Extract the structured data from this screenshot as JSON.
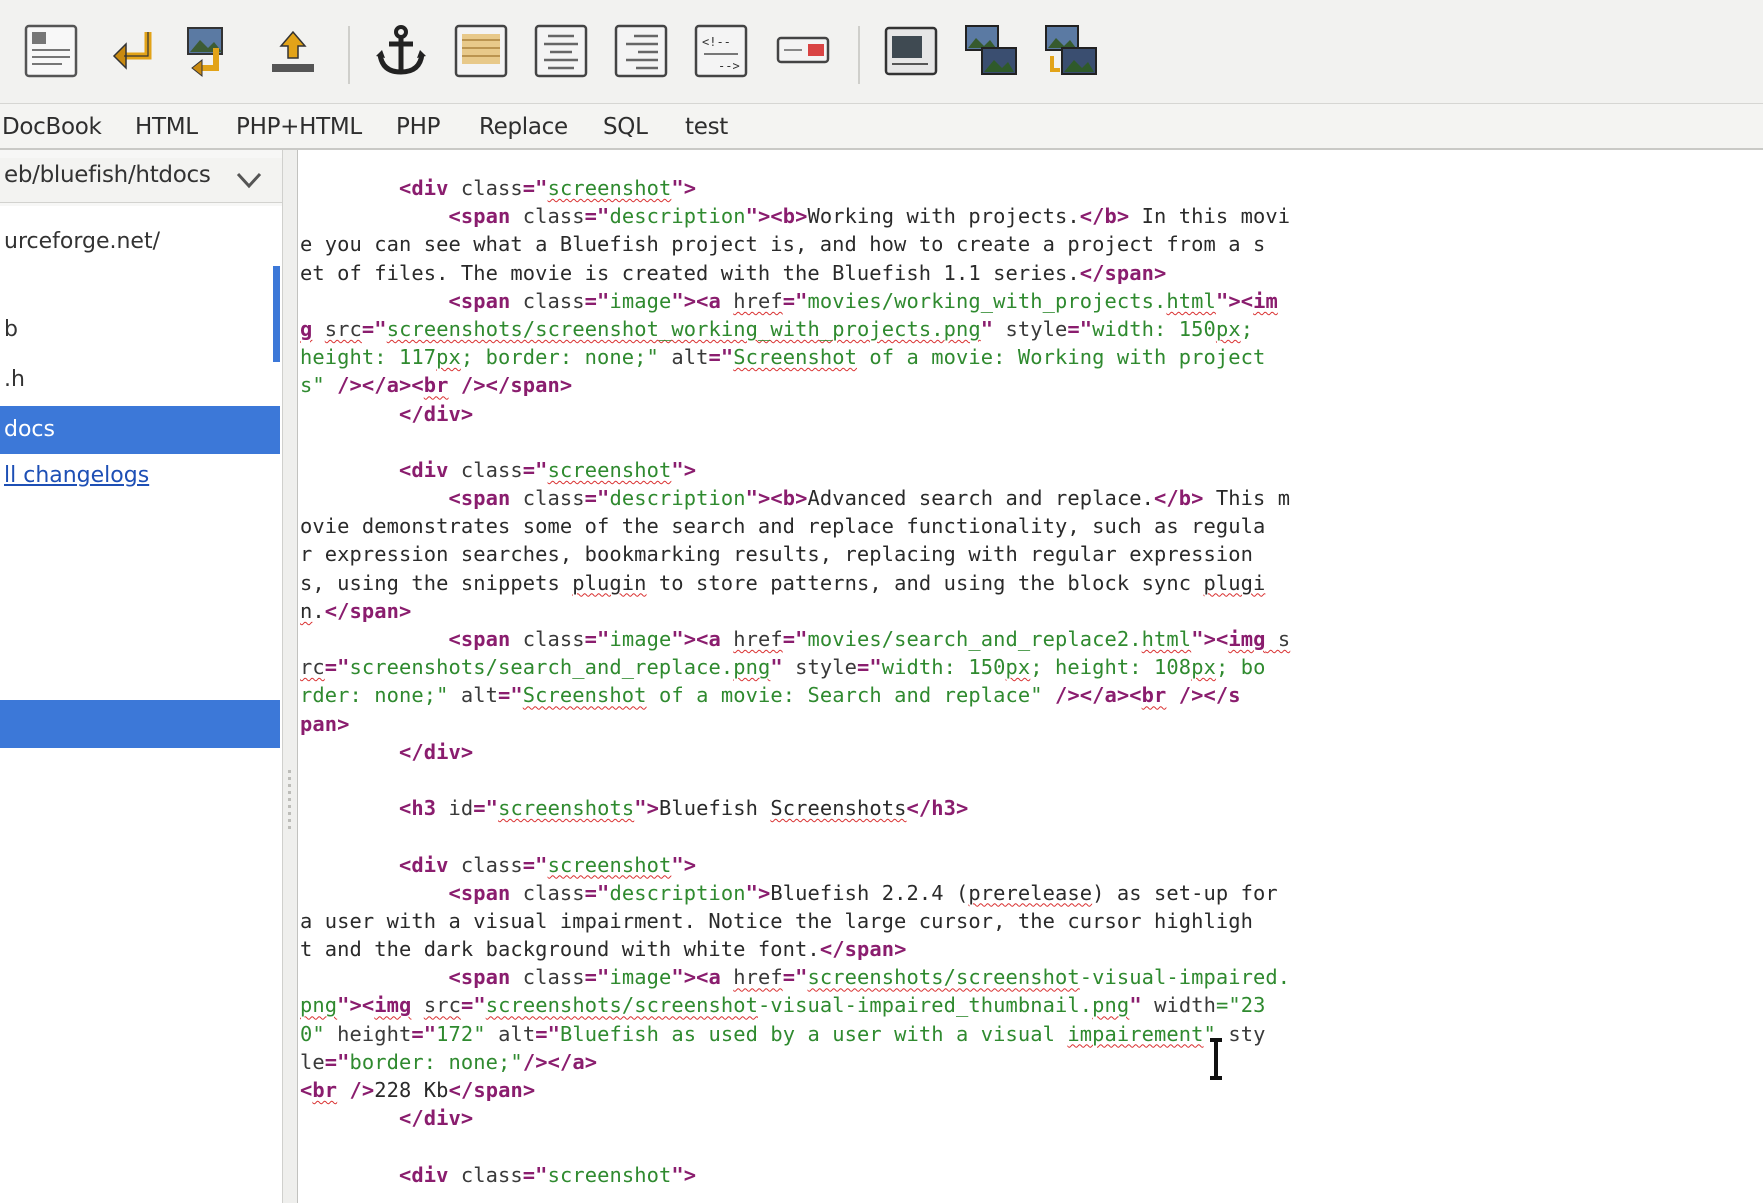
{
  "toolbar": {
    "buttons": [
      {
        "icon": "document-icon"
      },
      {
        "icon": "return-arrow-icon"
      },
      {
        "icon": "image-insert-icon"
      },
      {
        "icon": "upload-icon"
      },
      {
        "icon": "anchor-icon"
      },
      {
        "icon": "paragraph-icon"
      },
      {
        "icon": "align-center-icon"
      },
      {
        "icon": "align-right-icon"
      },
      {
        "icon": "comment-icon"
      },
      {
        "icon": "input-field-icon"
      },
      {
        "icon": "frame-icon"
      },
      {
        "icon": "thumbnail-icon"
      },
      {
        "icon": "multi-thumbnail-icon"
      }
    ]
  },
  "tabs": [
    "DocBook",
    "HTML",
    "PHP+HTML",
    "PHP",
    "Replace",
    "SQL",
    "test"
  ],
  "sidebar": {
    "path": "eb/bluefish/htdocs",
    "items": [
      {
        "label": "urceforge.net/",
        "type": "normal"
      },
      {
        "label": "",
        "type": "normal"
      },
      {
        "label": "b",
        "type": "normal"
      },
      {
        "label": ".h",
        "type": "normal"
      },
      {
        "label": "docs",
        "type": "selected"
      },
      {
        "label": "ll changelogs",
        "type": "link"
      },
      {
        "label": "",
        "type": "selected-empty"
      }
    ]
  },
  "colors": {
    "selection": "#3c78d8",
    "tag": "#8a1d6e",
    "string": "#2f8a2f",
    "spell_error": "#d93030"
  },
  "editor": {
    "lines": [
      [
        [
          "        ",
          "txt"
        ],
        [
          "<div ",
          "tag"
        ],
        [
          "class",
          "attr"
        ],
        [
          "=\"",
          "tag"
        ],
        [
          "screenshot",
          "str-sp"
        ],
        [
          "\">",
          "tag"
        ]
      ],
      [
        [
          "            ",
          "txt"
        ],
        [
          "<span ",
          "tag"
        ],
        [
          "class",
          "attr"
        ],
        [
          "=\"",
          "tag"
        ],
        [
          "description",
          "str"
        ],
        [
          "\"><b>",
          "tag"
        ],
        [
          "Working with projects.",
          "txt"
        ],
        [
          "</b>",
          "tag"
        ],
        [
          " In this movi",
          "txt"
        ]
      ],
      [
        [
          "e you can see what a Bluefish project is, and how to create a project from a s",
          "txt"
        ]
      ],
      [
        [
          "et of files. The movie is created with the Bluefish 1.1 series.",
          "txt"
        ],
        [
          "</span>",
          "tag"
        ]
      ],
      [
        [
          "            ",
          "txt"
        ],
        [
          "<span ",
          "tag"
        ],
        [
          "class",
          "attr"
        ],
        [
          "=\"",
          "tag"
        ],
        [
          "image",
          "str"
        ],
        [
          "\"><a ",
          "tag"
        ],
        [
          "href",
          "attr-sp"
        ],
        [
          "=\"",
          "tag"
        ],
        [
          "movies/working_with_projects.",
          "str"
        ],
        [
          "html",
          "str-sp"
        ],
        [
          "\"><",
          "tag"
        ],
        [
          "im",
          "tag-sp"
        ]
      ],
      [
        [
          "g",
          "tag-sp"
        ],
        [
          " ",
          "txt"
        ],
        [
          "src",
          "attr-sp"
        ],
        [
          "=\"",
          "tag"
        ],
        [
          "screenshots/screenshot_working_with_projects.png",
          "str-sp"
        ],
        [
          "\" ",
          "tag"
        ],
        [
          "style",
          "attr"
        ],
        [
          "=\"",
          "tag"
        ],
        [
          "width: 150",
          "str"
        ],
        [
          "px",
          "str-sp"
        ],
        [
          ";",
          "str"
        ]
      ],
      [
        [
          "height: 117",
          "str"
        ],
        [
          "px",
          "str-sp"
        ],
        [
          "; border: none;\" ",
          "str"
        ],
        [
          "alt",
          "attr"
        ],
        [
          "=\"",
          "tag"
        ],
        [
          "Screenshot",
          "str-sp"
        ],
        [
          " of a movie: Working with project",
          "str"
        ]
      ],
      [
        [
          "s\"",
          "str"
        ],
        [
          " /></a><",
          "tag"
        ],
        [
          "br",
          "tag-sp"
        ],
        [
          " /></span>",
          "tag"
        ]
      ],
      [
        [
          "        ",
          "txt"
        ],
        [
          "</div>",
          "tag"
        ]
      ],
      [
        [
          "",
          "txt"
        ]
      ],
      [
        [
          "        ",
          "txt"
        ],
        [
          "<div ",
          "tag"
        ],
        [
          "class",
          "attr"
        ],
        [
          "=\"",
          "tag"
        ],
        [
          "screenshot",
          "str-sp"
        ],
        [
          "\">",
          "tag"
        ]
      ],
      [
        [
          "            ",
          "txt"
        ],
        [
          "<span ",
          "tag"
        ],
        [
          "class",
          "attr"
        ],
        [
          "=\"",
          "tag"
        ],
        [
          "description",
          "str"
        ],
        [
          "\"><b>",
          "tag"
        ],
        [
          "Advanced search and replace.",
          "txt"
        ],
        [
          "</b>",
          "tag"
        ],
        [
          " This m",
          "txt"
        ]
      ],
      [
        [
          "ovie demonstrates some of the search and replace functionality, such as regula",
          "txt"
        ]
      ],
      [
        [
          "r expression searches, bookmarking results, replacing with regular expression",
          "txt"
        ]
      ],
      [
        [
          "s, using the snippets ",
          "txt"
        ],
        [
          "plugin",
          "txt-sp"
        ],
        [
          " to store patterns, and using the block sync ",
          "txt"
        ],
        [
          "plugi",
          "txt-sp"
        ]
      ],
      [
        [
          "n",
          "txt-sp"
        ],
        [
          ".",
          "txt"
        ],
        [
          "</span>",
          "tag"
        ]
      ],
      [
        [
          "            ",
          "txt"
        ],
        [
          "<span ",
          "tag"
        ],
        [
          "class",
          "attr"
        ],
        [
          "=\"",
          "tag"
        ],
        [
          "image",
          "str"
        ],
        [
          "\"><a ",
          "tag"
        ],
        [
          "href",
          "attr-sp"
        ],
        [
          "=\"",
          "tag"
        ],
        [
          "movies/search_and_replace2.",
          "str"
        ],
        [
          "html",
          "str-sp"
        ],
        [
          "\"><",
          "tag"
        ],
        [
          "img",
          "tag-sp"
        ],
        [
          " s",
          "attr-sp"
        ]
      ],
      [
        [
          "rc",
          "attr-sp"
        ],
        [
          "=\"",
          "tag"
        ],
        [
          "screenshots/search_and_replace.",
          "str"
        ],
        [
          "png",
          "str-sp"
        ],
        [
          "\" ",
          "tag"
        ],
        [
          "style",
          "attr"
        ],
        [
          "=\"",
          "tag"
        ],
        [
          "width: 150",
          "str"
        ],
        [
          "px",
          "str-sp"
        ],
        [
          "; height: 108",
          "str"
        ],
        [
          "px",
          "str-sp"
        ],
        [
          "; bo",
          "str"
        ]
      ],
      [
        [
          "rder: none;\" ",
          "str"
        ],
        [
          "alt",
          "attr"
        ],
        [
          "=\"",
          "tag"
        ],
        [
          "Screenshot",
          "str-sp"
        ],
        [
          " of a movie: Search and replace\"",
          "str"
        ],
        [
          " /></a><",
          "tag"
        ],
        [
          "br",
          "tag-sp"
        ],
        [
          " /></s",
          "tag"
        ]
      ],
      [
        [
          "pan>",
          "tag"
        ]
      ],
      [
        [
          "        ",
          "txt"
        ],
        [
          "</div>",
          "tag"
        ]
      ],
      [
        [
          "",
          "txt"
        ]
      ],
      [
        [
          "        ",
          "txt"
        ],
        [
          "<h3 ",
          "tag"
        ],
        [
          "id",
          "attr"
        ],
        [
          "=\"",
          "tag"
        ],
        [
          "screenshots",
          "str-sp"
        ],
        [
          "\">",
          "tag"
        ],
        [
          "Bluefish ",
          "txt"
        ],
        [
          "Screenshots",
          "txt-sp"
        ],
        [
          "</h3>",
          "tag"
        ]
      ],
      [
        [
          "",
          "txt"
        ]
      ],
      [
        [
          "        ",
          "txt"
        ],
        [
          "<div ",
          "tag"
        ],
        [
          "class",
          "attr"
        ],
        [
          "=\"",
          "tag"
        ],
        [
          "screenshot",
          "str-sp"
        ],
        [
          "\">",
          "tag"
        ]
      ],
      [
        [
          "            ",
          "txt"
        ],
        [
          "<span ",
          "tag"
        ],
        [
          "class",
          "attr"
        ],
        [
          "=\"",
          "tag"
        ],
        [
          "description",
          "str"
        ],
        [
          "\">",
          "tag"
        ],
        [
          "Bluefish 2.2.4 (",
          "txt"
        ],
        [
          "prerelease",
          "txt-sp"
        ],
        [
          ") as set-up for",
          "txt"
        ]
      ],
      [
        [
          "a user with a visual impairment. Notice the large cursor, the cursor highligh",
          "txt"
        ]
      ],
      [
        [
          "t and the dark background with white font.",
          "txt"
        ],
        [
          "</span>",
          "tag"
        ]
      ],
      [
        [
          "            ",
          "txt"
        ],
        [
          "<span ",
          "tag"
        ],
        [
          "class",
          "attr"
        ],
        [
          "=\"",
          "tag"
        ],
        [
          "image",
          "str"
        ],
        [
          "\"><a ",
          "tag"
        ],
        [
          "href",
          "attr-sp"
        ],
        [
          "=\"",
          "tag"
        ],
        [
          "screenshots/screenshot",
          "str-sp"
        ],
        [
          "-visual-impaired.",
          "str"
        ]
      ],
      [
        [
          "png",
          "str-sp"
        ],
        [
          "\"><",
          "tag"
        ],
        [
          "img",
          "tag-sp"
        ],
        [
          " ",
          "txt"
        ],
        [
          "src",
          "attr-sp"
        ],
        [
          "=\"",
          "tag"
        ],
        [
          "screenshots/screenshot",
          "str-sp"
        ],
        [
          "-visual-impaired_thumbnail.",
          "str"
        ],
        [
          "png",
          "str-sp"
        ],
        [
          "\" ",
          "tag"
        ],
        [
          "width",
          "attr"
        ],
        [
          "=\"23",
          "str"
        ]
      ],
      [
        [
          "0\" ",
          "str"
        ],
        [
          "height",
          "attr"
        ],
        [
          "=\"",
          "tag"
        ],
        [
          "172\" ",
          "str"
        ],
        [
          "alt",
          "attr"
        ],
        [
          "=\"",
          "tag"
        ],
        [
          "Bluefish as used by a user with a visual ",
          "str"
        ],
        [
          "impairement",
          "str-sp"
        ],
        [
          "\" ",
          "str"
        ],
        [
          "sty",
          "attr"
        ]
      ],
      [
        [
          "le",
          "attr"
        ],
        [
          "=\"",
          "tag"
        ],
        [
          "border: none;\"",
          "str"
        ],
        [
          "/></a>",
          "tag"
        ]
      ],
      [
        [
          "<",
          "tag"
        ],
        [
          "br",
          "tag-sp"
        ],
        [
          " />",
          "tag"
        ],
        [
          "228 Kb",
          "txt"
        ],
        [
          "</span>",
          "tag"
        ]
      ],
      [
        [
          "        ",
          "txt"
        ],
        [
          "</div>",
          "tag"
        ]
      ],
      [
        [
          "",
          "txt"
        ]
      ],
      [
        [
          "        ",
          "txt"
        ],
        [
          "<div ",
          "tag"
        ],
        [
          "class",
          "attr"
        ],
        [
          "=\"",
          "tag"
        ],
        [
          "screenshot",
          "str"
        ],
        [
          "\">",
          "tag"
        ]
      ]
    ]
  }
}
